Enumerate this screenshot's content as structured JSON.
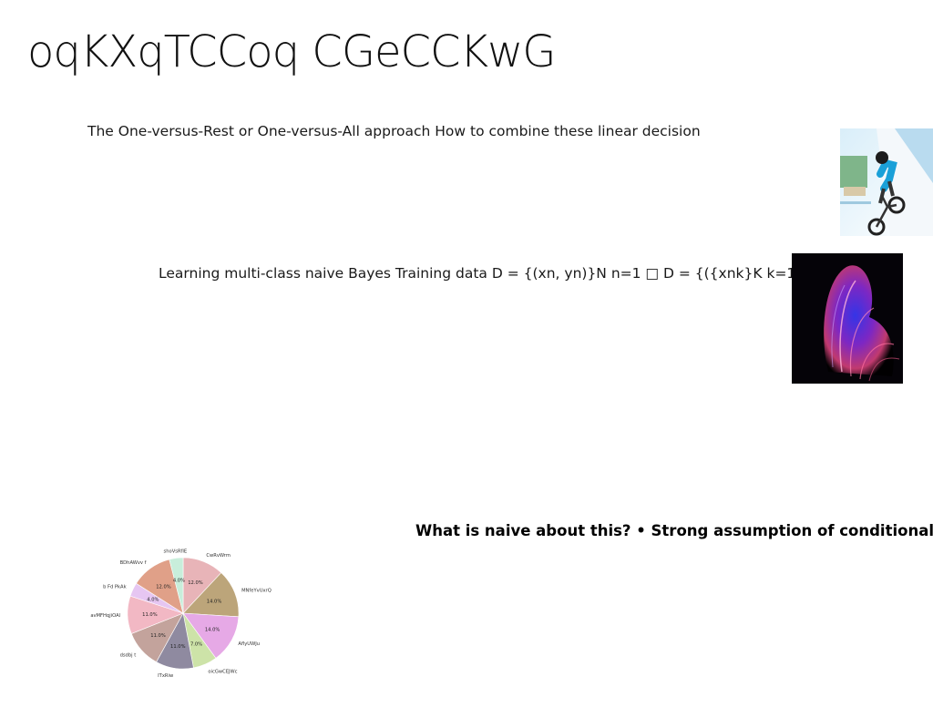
{
  "slide": {
    "title": "oqKXqTCCoq CGeCCKwG",
    "paragraph_1": "The One-versus-Rest or One-versus-All approach How to combine these linear decision",
    "paragraph_2": "Learning multi-class naive Bayes Training data D = {(xn, yn)}N n=1 □ D = {({xnk}K k=1,",
    "paragraph_3": "What is naive about this? • Strong assumption of conditional"
  },
  "images": {
    "bike": "bmx-rider-photo",
    "abstract": "abstract-light-art-photo"
  },
  "chart_data": {
    "type": "pie",
    "title": "",
    "categories": [
      "CwRvWrm",
      "MNfeYvUxrQ",
      "AflyUWJu",
      "oicGwCEJWc",
      "ITxRiw",
      "dsdbj t",
      "avMFHqjiOAl",
      "b Fd PkAk",
      "BDhAWvv f",
      "shoVsRfIE"
    ],
    "values": [
      12.0,
      14.0,
      14.0,
      7.0,
      11.0,
      11.0,
      11.0,
      4.0,
      12.0,
      4.0
    ],
    "labels": [
      "12.0%",
      "14.0%",
      "14.0%",
      "7.0%",
      "11.0%",
      "11.0%",
      "11.0%",
      "4.0%",
      "12.0%",
      "4.0%"
    ],
    "colors": [
      "#e8b4b8",
      "#bca57a",
      "#e6a9e6",
      "#cde3a8",
      "#8f8aa0",
      "#c3a39c",
      "#f2b8c4",
      "#e6c6f2",
      "#e0a088",
      "#c8eedb"
    ],
    "start_angle": "12 o'clock",
    "direction": "clockwise",
    "legend": "none"
  }
}
